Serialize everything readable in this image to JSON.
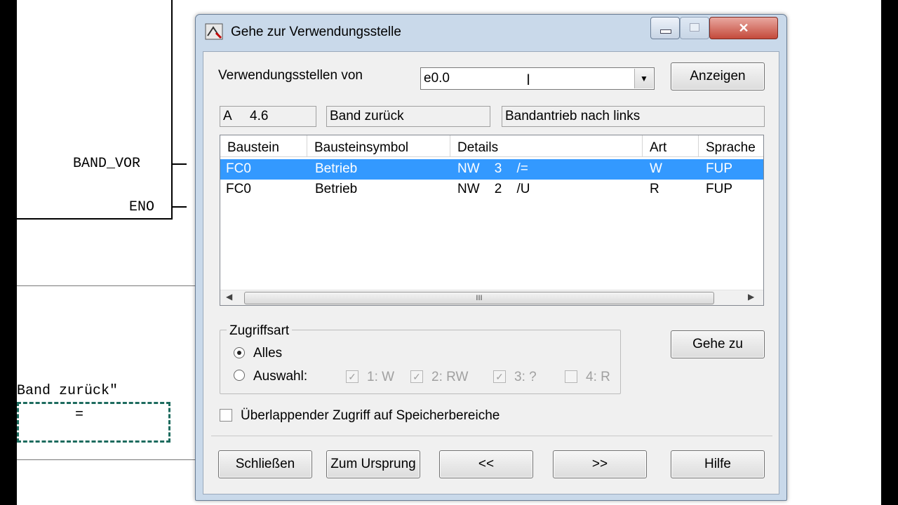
{
  "background": {
    "labels": {
      "band_vor": "BAND_VOR",
      "eno": "ENO",
      "band_zurueck": "Band zurück\"",
      "assign": "="
    }
  },
  "dialog": {
    "title": "Gehe zur Verwendungsstelle",
    "usage_label": "Verwendungsstellen von",
    "usage_value": "e0.0",
    "show_button": "Anzeigen",
    "info": {
      "address": "A     4.6",
      "symbol": "Band zurück",
      "comment": "Bandantrieb nach links"
    },
    "table": {
      "headers": [
        "Baustein",
        "Bausteinsymbol",
        "Details",
        "Art",
        "Sprache"
      ],
      "rows": [
        {
          "block": "FC0",
          "symbol": "Betrieb",
          "details": "NW    3    /=",
          "type": "W",
          "language": "FUP"
        },
        {
          "block": "FC0",
          "symbol": "Betrieb",
          "details": "NW    2    /U",
          "type": "R",
          "language": "FUP"
        }
      ],
      "scroll_grip": "III"
    },
    "access": {
      "title": "Zugriffsart",
      "option_all": "Alles",
      "option_select": "Auswahl:",
      "checks": [
        {
          "label": "1: W",
          "checked": true
        },
        {
          "label": "2: RW",
          "checked": true
        },
        {
          "label": "3: ?",
          "checked": true
        },
        {
          "label": "4: R",
          "checked": false
        }
      ]
    },
    "goto_button": "Gehe zu",
    "overlap_label": "Überlappender Zugriff auf Speicherbereiche",
    "buttons": {
      "close": "Schließen",
      "origin": "Zum Ursprung",
      "prev": "<<",
      "next": ">>",
      "help": "Hilfe"
    }
  }
}
